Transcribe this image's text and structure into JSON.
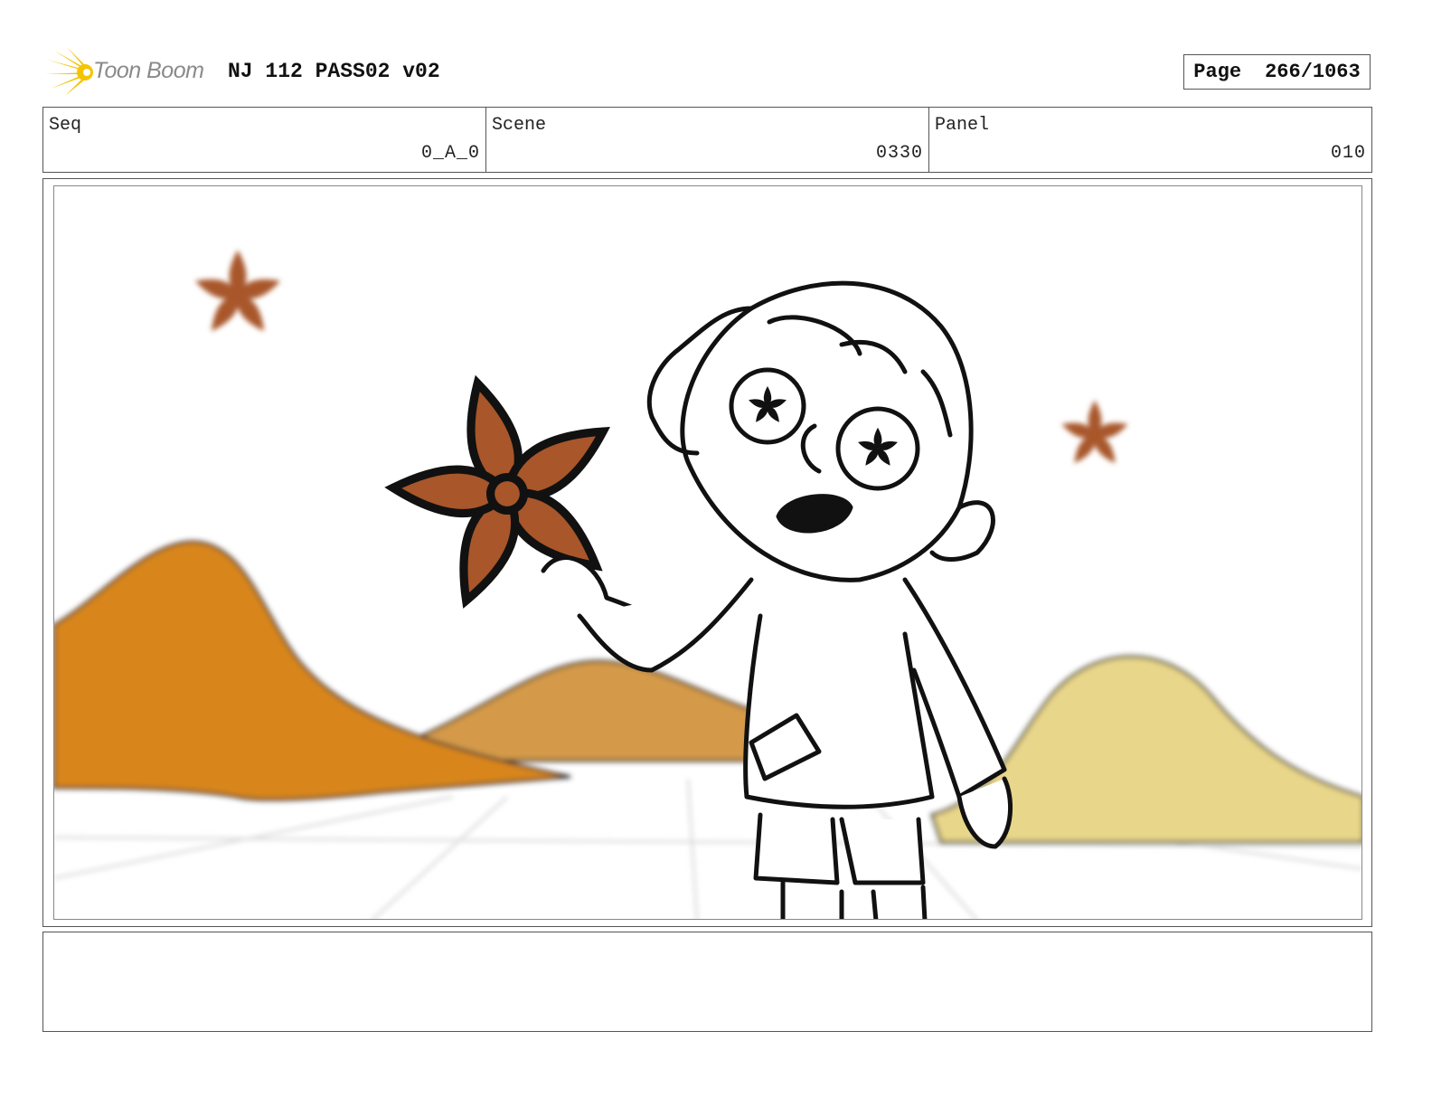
{
  "header": {
    "logo_text": "Toon Boom",
    "title": "NJ 112 PASS02 v02",
    "page_label": "Page",
    "page_value": "266/1063"
  },
  "info": {
    "seq_label": "Seq",
    "seq_value": "0_A_0",
    "scene_label": "Scene",
    "scene_value": "0330",
    "panel_label": "Panel",
    "panel_value": "010"
  },
  "caption": {
    "text": ""
  },
  "colors": {
    "mountain_orange": "#d8861f",
    "mountain_tan": "#d49a48",
    "mountain_yellow": "#e8d68a",
    "star_anise": "#a8562a",
    "logo_yellow": "#f5c400"
  }
}
